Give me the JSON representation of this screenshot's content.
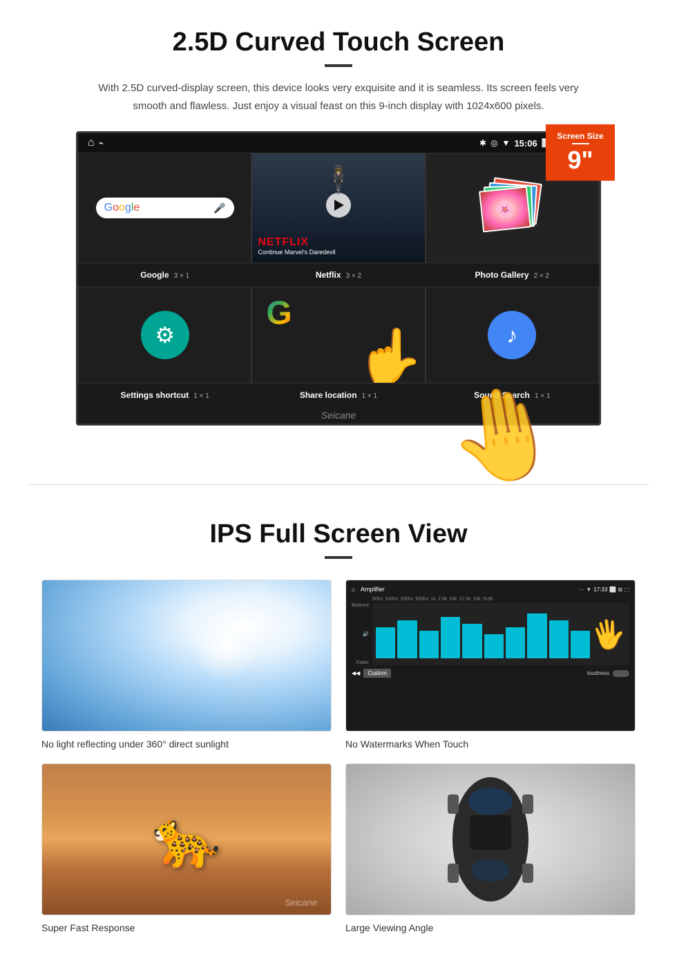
{
  "section1": {
    "title": "2.5D Curved Touch Screen",
    "description": "With 2.5D curved-display screen, this device looks very exquisite and it is seamless. Its screen feels very smooth and flawless. Just enjoy a visual feast on this 9-inch display with 1024x600 pixels.",
    "badge": {
      "label": "Screen Size",
      "size": "9\""
    },
    "statusBar": {
      "time": "15:06"
    },
    "apps": [
      {
        "name": "Google",
        "grid": "3 × 1"
      },
      {
        "name": "Netflix",
        "grid": "3 × 2"
      },
      {
        "name": "Photo Gallery",
        "grid": "2 × 2"
      },
      {
        "name": "Settings shortcut",
        "grid": "1 × 1"
      },
      {
        "name": "Share location",
        "grid": "1 × 1"
      },
      {
        "name": "Sound Search",
        "grid": "1 × 1"
      }
    ],
    "netflix": {
      "brand": "NETFLIX",
      "subtitle": "Continue Marvel's Daredevil"
    },
    "watermark": "Seicane"
  },
  "section2": {
    "title": "IPS Full Screen View",
    "items": [
      {
        "label": "No light reflecting under 360° direct sunlight",
        "type": "sunlight"
      },
      {
        "label": "No Watermarks When Touch",
        "type": "amplifier"
      },
      {
        "label": "Super Fast Response",
        "type": "cheetah"
      },
      {
        "label": "Large Viewing Angle",
        "type": "car"
      }
    ],
    "watermark": "Seicane"
  }
}
